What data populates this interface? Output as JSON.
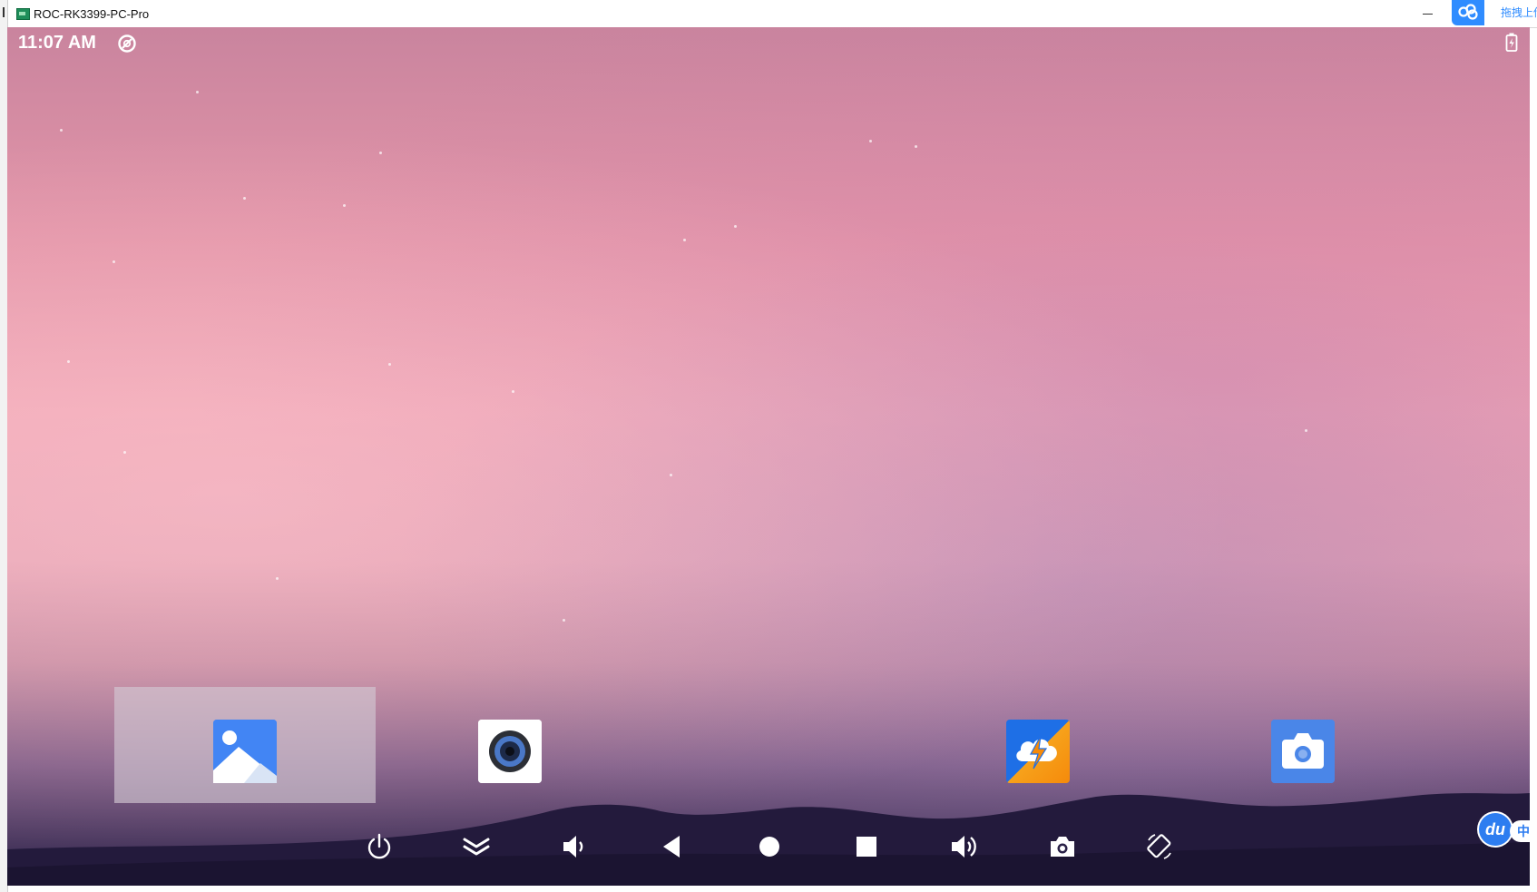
{
  "window": {
    "title": "ROC-RK3399-PC-Pro",
    "upload_label": "拖拽上传"
  },
  "status_bar": {
    "time": "11:07 AM"
  },
  "apps": [
    {
      "name": "gallery",
      "icon": "gallery-icon",
      "color": "#4285f4"
    },
    {
      "name": "music",
      "icon": "speaker-icon",
      "color": "#ffffff"
    },
    {
      "name": "booster",
      "icon": "cloud-bolt-icon",
      "color": "#1a73e8"
    },
    {
      "name": "camera",
      "icon": "camera-icon",
      "color": "#4a86e8"
    }
  ],
  "nav_buttons": [
    {
      "name": "power",
      "icon": "power-icon"
    },
    {
      "name": "notifications",
      "icon": "expand-down-icon"
    },
    {
      "name": "volume-down",
      "icon": "volume-down-icon"
    },
    {
      "name": "back",
      "icon": "back-icon"
    },
    {
      "name": "home",
      "icon": "home-icon"
    },
    {
      "name": "recents",
      "icon": "recents-icon"
    },
    {
      "name": "volume-up",
      "icon": "volume-up-icon"
    },
    {
      "name": "screenshot",
      "icon": "camera-icon"
    },
    {
      "name": "rotate",
      "icon": "rotate-icon"
    }
  ],
  "ime": {
    "badge": "du",
    "lang": "中"
  }
}
